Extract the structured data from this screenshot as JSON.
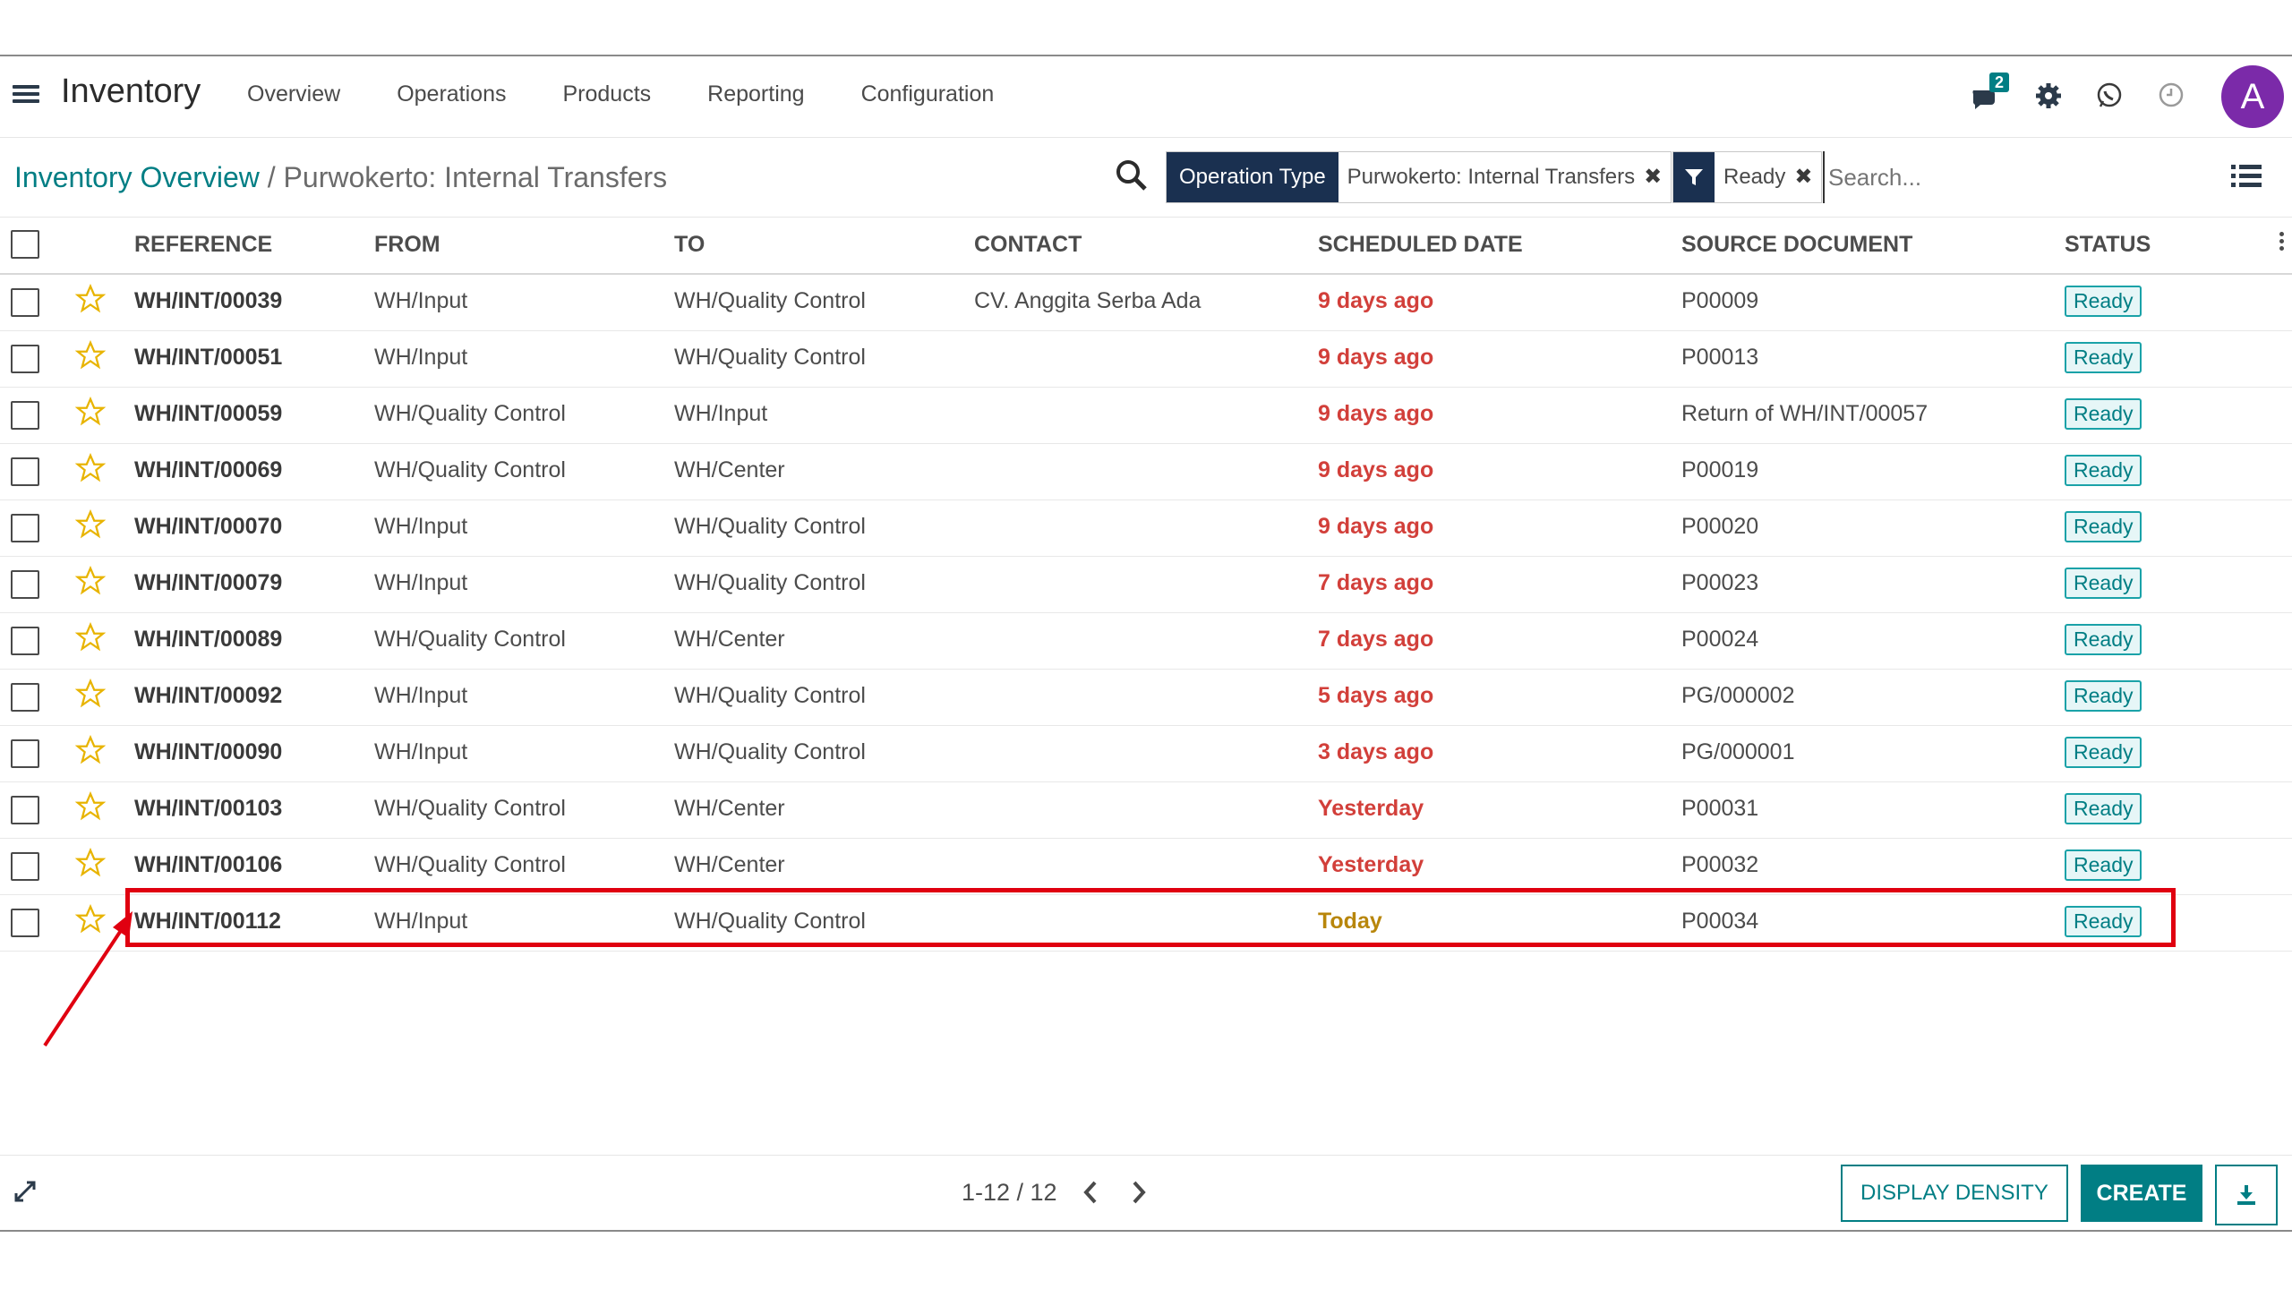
{
  "app": {
    "title": "Inventory"
  },
  "nav": {
    "items": [
      "Overview",
      "Operations",
      "Products",
      "Reporting",
      "Configuration"
    ],
    "messages_badge": "2",
    "avatar_letter": "A"
  },
  "breadcrumb": {
    "parent": "Inventory Overview",
    "separator": "/",
    "current": "Purwokerto: Internal Transfers"
  },
  "search": {
    "facet1_label": "Operation Type",
    "facet1_value": "Purwokerto: Internal Transfers",
    "facet2_value": "Ready",
    "placeholder": "Search...",
    "remove_glyph": "✖"
  },
  "table": {
    "headers": [
      "REFERENCE",
      "FROM",
      "TO",
      "CONTACT",
      "SCHEDULED DATE",
      "SOURCE DOCUMENT",
      "STATUS"
    ],
    "rows": [
      {
        "ref": "WH/INT/00039",
        "from": "WH/Input",
        "to": "WH/Quality Control",
        "contact": "CV. Anggita Serba Ada",
        "date": "9 days ago",
        "source": "P00009",
        "status": "Ready"
      },
      {
        "ref": "WH/INT/00051",
        "from": "WH/Input",
        "to": "WH/Quality Control",
        "contact": "",
        "date": "9 days ago",
        "source": "P00013",
        "status": "Ready"
      },
      {
        "ref": "WH/INT/00059",
        "from": "WH/Quality Control",
        "to": "WH/Input",
        "contact": "",
        "date": "9 days ago",
        "source": "Return of WH/INT/00057",
        "status": "Ready"
      },
      {
        "ref": "WH/INT/00069",
        "from": "WH/Quality Control",
        "to": "WH/Center",
        "contact": "",
        "date": "9 days ago",
        "source": "P00019",
        "status": "Ready"
      },
      {
        "ref": "WH/INT/00070",
        "from": "WH/Input",
        "to": "WH/Quality Control",
        "contact": "",
        "date": "9 days ago",
        "source": "P00020",
        "status": "Ready"
      },
      {
        "ref": "WH/INT/00079",
        "from": "WH/Input",
        "to": "WH/Quality Control",
        "contact": "",
        "date": "7 days ago",
        "source": "P00023",
        "status": "Ready"
      },
      {
        "ref": "WH/INT/00089",
        "from": "WH/Quality Control",
        "to": "WH/Center",
        "contact": "",
        "date": "7 days ago",
        "source": "P00024",
        "status": "Ready"
      },
      {
        "ref": "WH/INT/00092",
        "from": "WH/Input",
        "to": "WH/Quality Control",
        "contact": "",
        "date": "5 days ago",
        "source": "PG/000002",
        "status": "Ready"
      },
      {
        "ref": "WH/INT/00090",
        "from": "WH/Input",
        "to": "WH/Quality Control",
        "contact": "",
        "date": "3 days ago",
        "source": "PG/000001",
        "status": "Ready"
      },
      {
        "ref": "WH/INT/00103",
        "from": "WH/Quality Control",
        "to": "WH/Center",
        "contact": "",
        "date": "Yesterday",
        "source": "P00031",
        "status": "Ready"
      },
      {
        "ref": "WH/INT/00106",
        "from": "WH/Quality Control",
        "to": "WH/Center",
        "contact": "",
        "date": "Yesterday",
        "source": "P00032",
        "status": "Ready"
      },
      {
        "ref": "WH/INT/00112",
        "from": "WH/Input",
        "to": "WH/Quality Control",
        "contact": "",
        "date": "Today",
        "source": "P00034",
        "status": "Ready"
      }
    ]
  },
  "footer": {
    "pager": "1-12 / 12",
    "density_label": "DISPLAY DENSITY",
    "create_label": "CREATE"
  },
  "colors": {
    "brand": "#017e84",
    "facet_dark": "#1a3050",
    "overdue": "#d23f3a",
    "today": "#b8860b",
    "highlight": "#e00010",
    "avatar": "#7b2aa9"
  }
}
